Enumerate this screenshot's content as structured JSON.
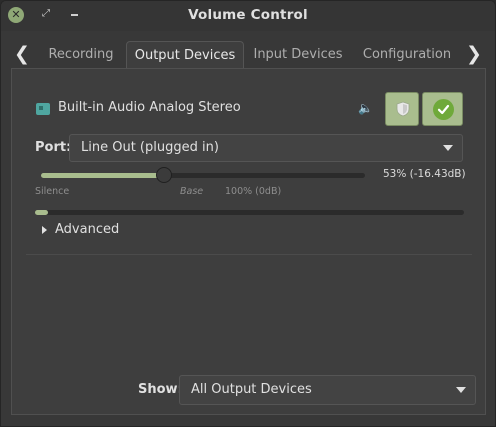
{
  "window": {
    "title": "Volume Control",
    "close_glyph": "✕",
    "maximize_glyph": "⤢"
  },
  "tabs": [
    {
      "label": "Recording",
      "active": false
    },
    {
      "label": "Output Devices",
      "active": true
    },
    {
      "label": "Input Devices",
      "active": false
    },
    {
      "label": "Configuration",
      "active": false
    }
  ],
  "nav": {
    "prev_glyph": "❮",
    "next_glyph": "❯"
  },
  "device": {
    "name": "Built-in Audio Analog Stereo",
    "icon": "sound-card-icon",
    "speaker_glyph": "🔈",
    "port_label": "Port:",
    "port_value": "Line Out (plugged in)",
    "volume_fraction": 0.53,
    "volume_text": "53% (-16.43dB)",
    "peak_fraction": 0.03,
    "marks": {
      "silence": "Silence",
      "base": "Base",
      "full": "100% (0dB)"
    },
    "advanced_label": "Advanced",
    "mute_state": false,
    "is_default": true
  },
  "footer": {
    "show_label": "Show:",
    "show_value": "All Output Devices"
  },
  "colors": {
    "accent": "#a9bd8e",
    "check": "#6fa93a",
    "device_icon": "#4fa6a0"
  }
}
